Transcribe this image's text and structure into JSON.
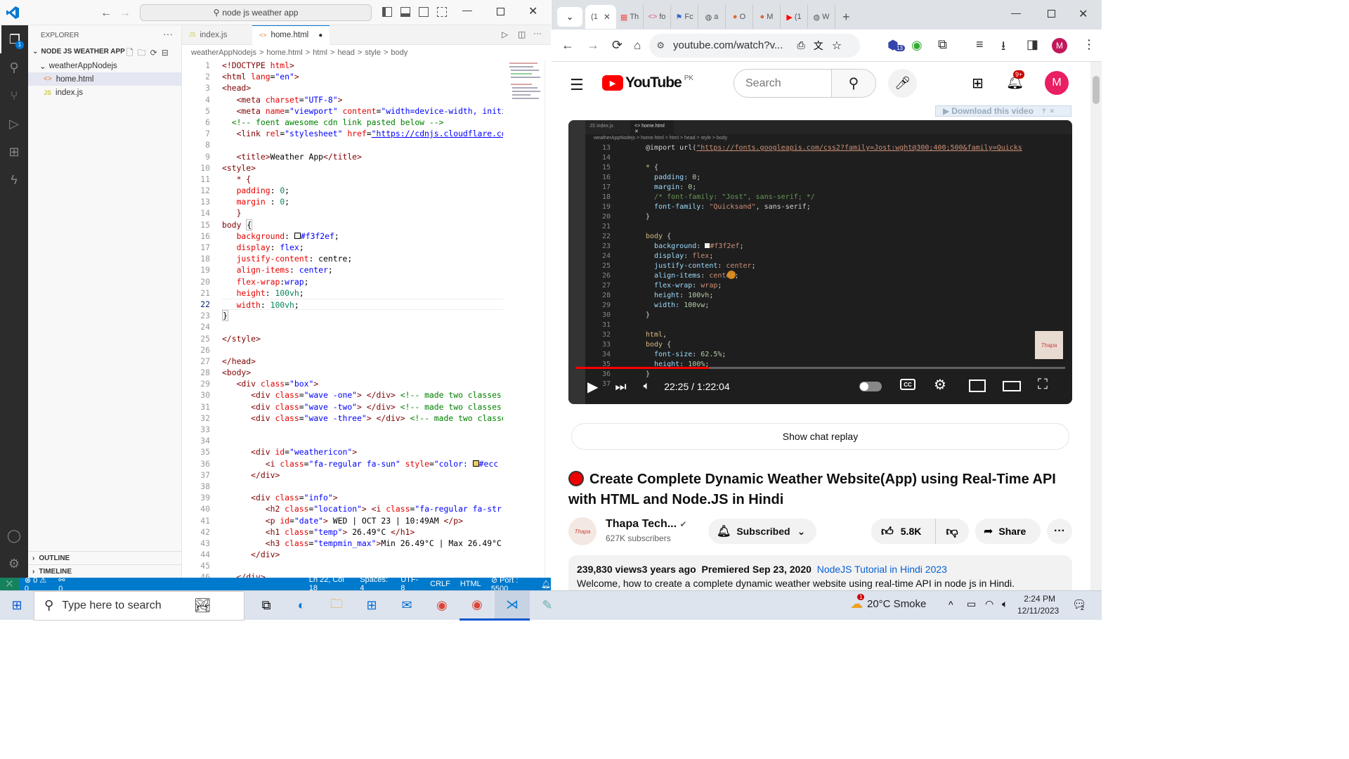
{
  "vscode": {
    "search": "node js weather app",
    "explorer_title": "EXPLORER",
    "project": "NODE JS WEATHER APP",
    "folder": "weatherAppNodejs",
    "files": [
      "home.html",
      "index.js"
    ],
    "outline": "OUTLINE",
    "timeline": "TIMELINE",
    "tabs": [
      "index.js",
      "home.html"
    ],
    "breadcrumb": [
      "weatherAppNodejs",
      ">",
      "home.html",
      ">",
      "html",
      ">",
      "head",
      ">",
      "style",
      ">",
      "body"
    ],
    "line_numbers": [
      "1",
      "2",
      "3",
      "4",
      "5",
      "6",
      "7",
      "8",
      "9",
      "10",
      "11",
      "12",
      "13",
      "14",
      "15",
      "16",
      "17",
      "18",
      "19",
      "20",
      "21",
      "22",
      "23",
      "24",
      "25",
      "26",
      "27",
      "28",
      "29",
      "30",
      "31",
      "32",
      "33",
      "34",
      "35",
      "36",
      "37",
      "38",
      "39",
      "40",
      "41",
      "42",
      "43",
      "44",
      "45",
      "46"
    ],
    "status": {
      "errors": "0",
      "warnings": "0",
      "ports": "0",
      "position": "Ln 22, Col 18",
      "spaces": "Spaces: 4",
      "encoding": "UTF-8",
      "eol": "CRLF",
      "lang": "HTML",
      "port": "Port : 5500"
    }
  },
  "browser": {
    "tab_labels": [
      "(1",
      "Th",
      "fo",
      "Fc",
      "a",
      "O",
      "M",
      "(1",
      "W"
    ],
    "url": "youtube.com/watch?v...",
    "profile": "M",
    "extension_badge": "13"
  },
  "youtube": {
    "logo": "YouTube",
    "region": "PK",
    "search_placeholder": "Search",
    "notif_badge": "9+",
    "avatar": "M",
    "download_btn": "Download this video",
    "time": "22:25 / 1:22:04",
    "progress": 0.273,
    "chat_replay": "Show chat replay",
    "title": "Create Complete Dynamic Weather Website(App) using Real-Time API with HTML and Node.JS in Hindi",
    "channel": "Thapa Tech...",
    "subscribers": "627K subscribers",
    "subscribed": "Subscribed",
    "likes": "5.8K",
    "share": "Share",
    "views": "239,830 views",
    "age": "3 years ago",
    "premiered": "Premiered Sep 23, 2020",
    "playlist": "NodeJS Tutorial in Hindi 2023",
    "description": "Welcome, how to create a complete dynamic weather website using real-time API in node js in Hindi."
  },
  "video_code": {
    "line_numbers": [
      "13",
      "14",
      "15",
      "16",
      "17",
      "18",
      "19",
      "20",
      "21",
      "22",
      "23",
      "24",
      "25",
      "26",
      "27",
      "28",
      "29",
      "30",
      "31",
      "32",
      "33",
      "34",
      "35",
      "36",
      "37"
    ]
  },
  "taskbar": {
    "search_placeholder": "Type here to search",
    "weather": "20°C  Smoke",
    "weather_badge": "1",
    "time": "2:24 PM",
    "date": "12/11/2023",
    "notif_count": "2"
  }
}
